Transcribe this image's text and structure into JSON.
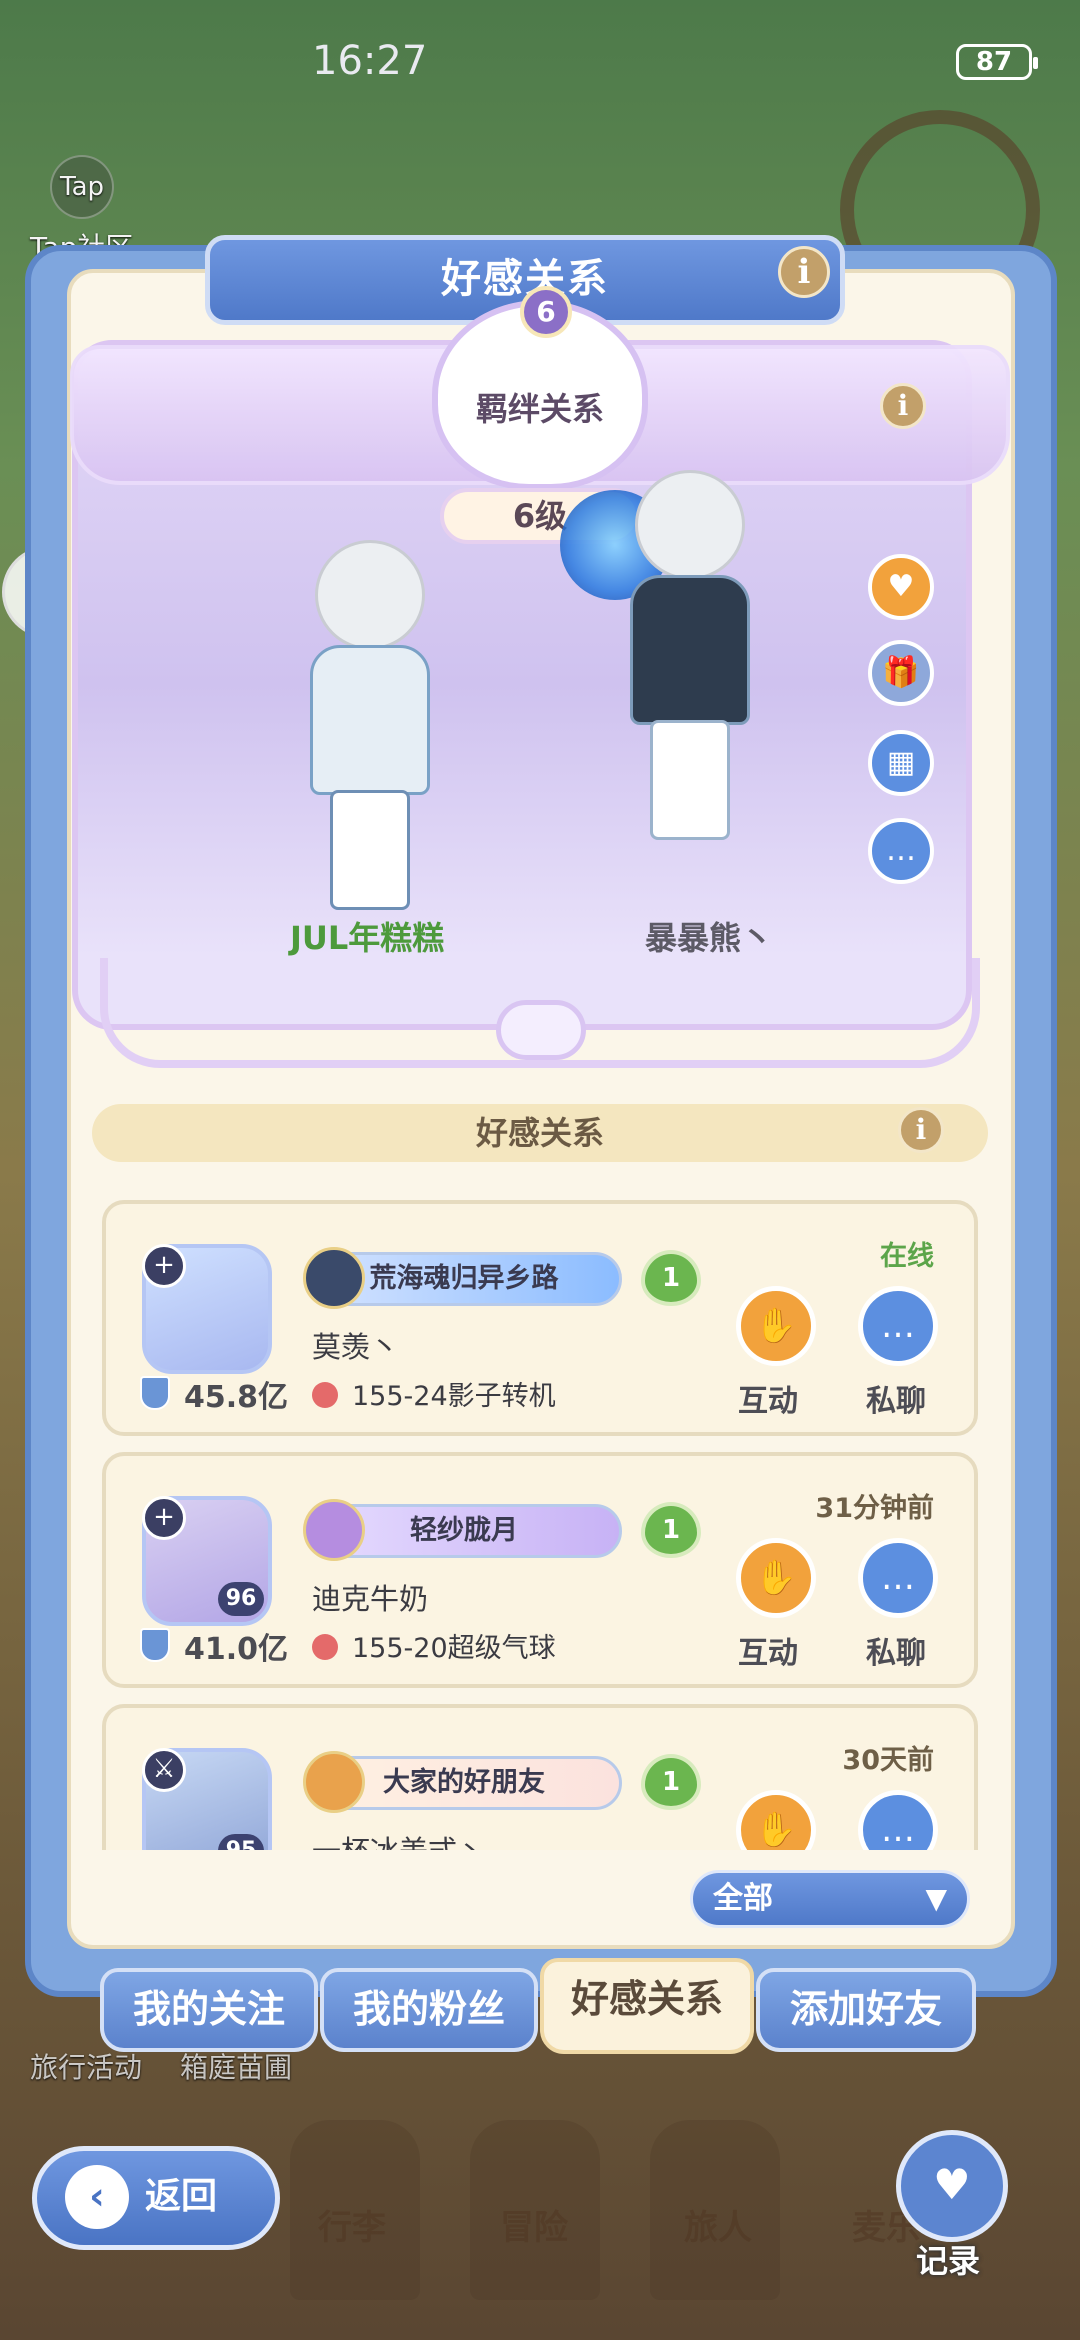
{
  "status_bar": {
    "time": "16:27",
    "battery": "87"
  },
  "background": {
    "tap_logo": "Tap",
    "tap_community": "Tap社区",
    "travel_event": "旅行活动",
    "garden": "箱庭苗圃"
  },
  "panel": {
    "title": "好感关系",
    "info": "i"
  },
  "bond": {
    "level_badge": "6",
    "label": "羁绊关系",
    "level_text": "6级",
    "player_left": "JUL年糕糕",
    "player_right": "暴暴熊丶",
    "side_icons": [
      "heart-gift-icon",
      "gift-box-icon",
      "calendar-icon",
      "chat-bubble-icon"
    ]
  },
  "section": {
    "title": "好感关系"
  },
  "friends": [
    {
      "title": "荒海魂归异乡路",
      "hearts": "1",
      "nick": "莫羡丶",
      "power": "45.8亿",
      "location": "155-24影子转机",
      "status": "在线",
      "online": true,
      "level": "",
      "badge": "+"
    },
    {
      "title": "轻纱胧月",
      "hearts": "1",
      "nick": "迪克牛奶",
      "power": "41.0亿",
      "location": "155-20超级气球",
      "status": "31分钟前",
      "online": false,
      "level": "96",
      "badge": "+"
    },
    {
      "title": "大家的好朋友",
      "hearts": "1",
      "nick": "一杯冰美式丶",
      "power": "",
      "location": "",
      "status": "30天前",
      "online": false,
      "level": "95",
      "badge": "⚔"
    }
  ],
  "actions": {
    "interact": "互动",
    "chat": "私聊"
  },
  "filter": {
    "value": "全部",
    "arrow": "▼"
  },
  "tabs": [
    "我的关注",
    "我的粉丝",
    "好感关系",
    "添加好友"
  ],
  "bottom": {
    "back": "返回",
    "record": "记录",
    "luggage": "行李",
    "adventure": "冒险",
    "traveler": "旅人",
    "more": "麦乐"
  }
}
